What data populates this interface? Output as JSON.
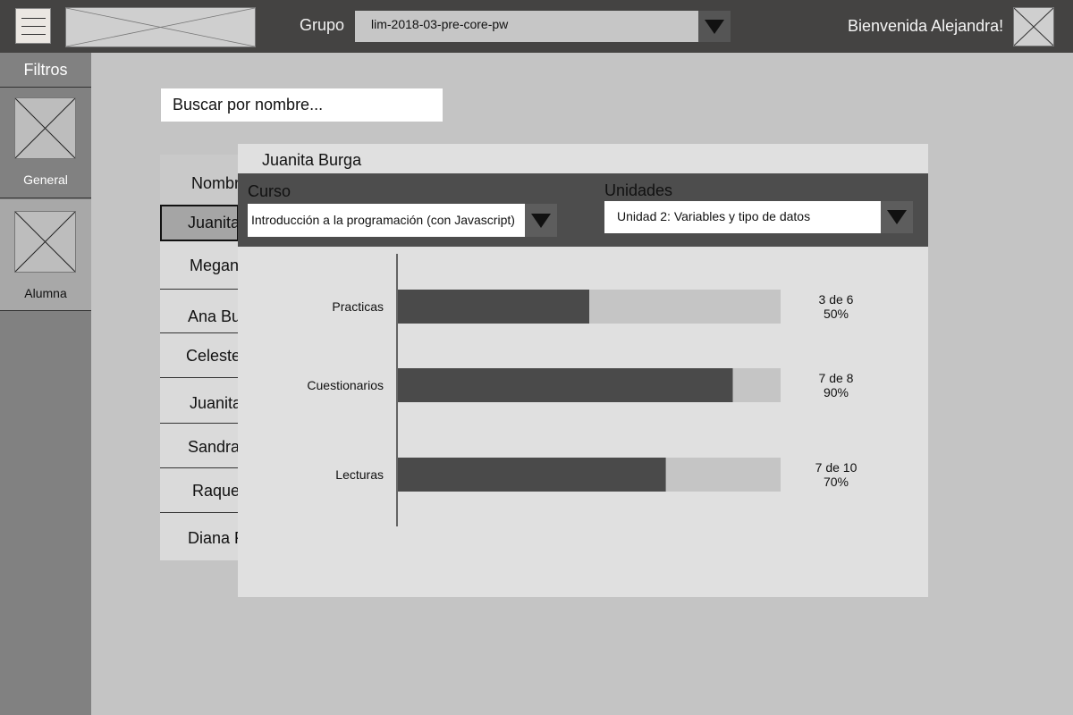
{
  "header": {
    "group_label": "Grupo",
    "group_value": "lim-2018-03-pre-core-pw",
    "welcome": "Bienvenida Alejandra!"
  },
  "sidebar": {
    "title": "Filtros",
    "items": [
      {
        "label": "General",
        "icon": "image-placeholder-icon"
      },
      {
        "label": "Alumna",
        "icon": "image-placeholder-icon"
      }
    ]
  },
  "search": {
    "placeholder": "Buscar por nombre..."
  },
  "student_list": {
    "header": "Nombr",
    "rows": [
      "Juanita",
      "Megan",
      "Ana Bu",
      "Celeste",
      "Juanita",
      "Sandra",
      "Raque",
      "Diana F"
    ],
    "selected_index": 0
  },
  "detail": {
    "student_name": "Juanita Burga",
    "course_label": "Curso",
    "course_value": "Introducción a la programación (con Javascript)",
    "units_label": "Unidades",
    "units_value": "Unidad 2: Variables y tipo de datos"
  },
  "colors": {
    "bar_fill": "#4a4a4a",
    "bar_track": "#c5c5c5"
  },
  "chart_data": {
    "type": "bar",
    "orientation": "horizontal",
    "stacked": false,
    "categories": [
      "Practicas",
      "Cuestionarios",
      "Lecturas"
    ],
    "series": [
      {
        "values": [
          3,
          7,
          7
        ]
      },
      {
        "values": [
          6,
          8,
          10
        ]
      }
    ],
    "percentages": [
      50,
      90,
      70
    ],
    "annotations": [
      {
        "count": "3 de 6",
        "percent": "50%"
      },
      {
        "count": "7 de 8",
        "percent": "90%"
      },
      {
        "count": "7 de 10",
        "percent": "70%"
      }
    ],
    "xlim": [
      0,
      100
    ],
    "grid": false,
    "legend": "none"
  }
}
